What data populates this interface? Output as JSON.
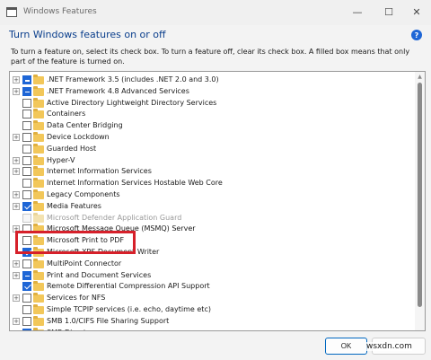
{
  "window": {
    "title": "Windows Features",
    "heading": "Turn Windows features on or off",
    "description": "To turn a feature on, select its check box. To turn a feature off, clear its check box. A filled box means that only part of the feature is turned on.",
    "controls": {
      "minimize": "—",
      "maximize": "☐",
      "close": "✕"
    },
    "help": "?"
  },
  "features": [
    {
      "label": ".NET Framework 3.5 (includes .NET 2.0 and 3.0)",
      "expandable": true,
      "state": "partial"
    },
    {
      "label": ".NET Framework 4.8 Advanced Services",
      "expandable": true,
      "state": "partial"
    },
    {
      "label": "Active Directory Lightweight Directory Services",
      "expandable": false,
      "state": "unchecked"
    },
    {
      "label": "Containers",
      "expandable": false,
      "state": "unchecked"
    },
    {
      "label": "Data Center Bridging",
      "expandable": false,
      "state": "unchecked"
    },
    {
      "label": "Device Lockdown",
      "expandable": true,
      "state": "unchecked"
    },
    {
      "label": "Guarded Host",
      "expandable": false,
      "state": "unchecked"
    },
    {
      "label": "Hyper-V",
      "expandable": true,
      "state": "unchecked"
    },
    {
      "label": "Internet Information Services",
      "expandable": true,
      "state": "unchecked"
    },
    {
      "label": "Internet Information Services Hostable Web Core",
      "expandable": false,
      "state": "unchecked"
    },
    {
      "label": "Legacy Components",
      "expandable": true,
      "state": "unchecked"
    },
    {
      "label": "Media Features",
      "expandable": true,
      "state": "checked"
    },
    {
      "label": "Microsoft Defender Application Guard",
      "expandable": false,
      "state": "disabled"
    },
    {
      "label": "Microsoft Message Queue (MSMQ) Server",
      "expandable": true,
      "state": "unchecked"
    },
    {
      "label": "Microsoft Print to PDF",
      "expandable": false,
      "state": "unchecked"
    },
    {
      "label": "Microsoft XPS Document Writer",
      "expandable": false,
      "state": "checked"
    },
    {
      "label": "MultiPoint Connector",
      "expandable": true,
      "state": "unchecked"
    },
    {
      "label": "Print and Document Services",
      "expandable": true,
      "state": "partial"
    },
    {
      "label": "Remote Differential Compression API Support",
      "expandable": false,
      "state": "checked"
    },
    {
      "label": "Services for NFS",
      "expandable": true,
      "state": "unchecked"
    },
    {
      "label": "Simple TCPIP services (i.e. echo, daytime etc)",
      "expandable": false,
      "state": "unchecked"
    },
    {
      "label": "SMB 1.0/CIFS File Sharing Support",
      "expandable": true,
      "state": "unchecked"
    },
    {
      "label": "SMB Direct",
      "expandable": false,
      "state": "checked"
    }
  ],
  "buttons": {
    "ok": "OK"
  },
  "watermark": "wsxdn.com"
}
